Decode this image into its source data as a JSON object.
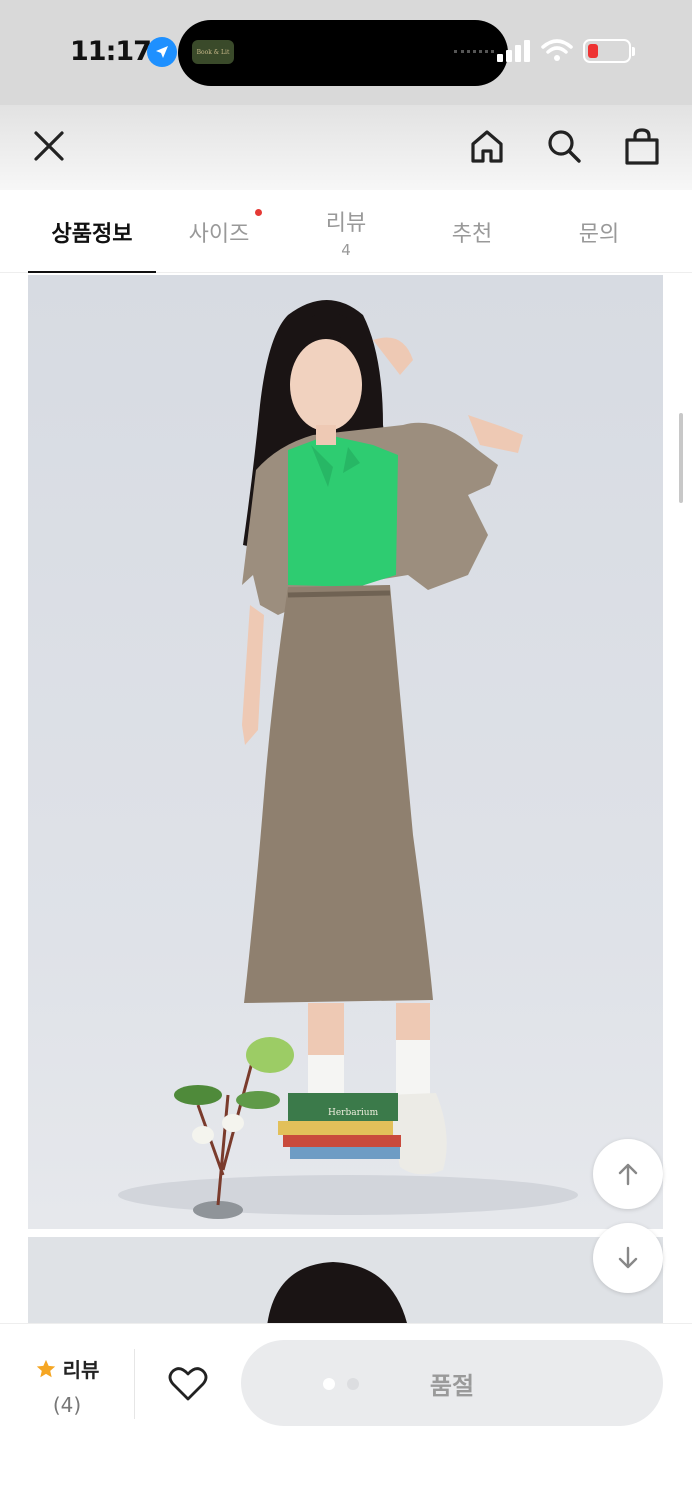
{
  "status_bar": {
    "time": "11:17",
    "island_thumb_text": "Book & Lit"
  },
  "nav": {
    "icons": [
      "close-icon",
      "home-icon",
      "search-icon",
      "shopping-bag-icon"
    ]
  },
  "tabs": [
    {
      "label": "상품정보",
      "active": true
    },
    {
      "label": "사이즈",
      "has_dot": true
    },
    {
      "label": "리뷰",
      "count": "4"
    },
    {
      "label": "추천"
    },
    {
      "label": "문의"
    }
  ],
  "photo": {
    "book_label": "Herbarium"
  },
  "bottom_bar": {
    "review_label": "리뷰",
    "review_count": "(4)",
    "soldout_label": "품절"
  },
  "colors": {
    "star": "#f5a623",
    "red_dot": "#e53935",
    "cardigan_green": "#2ecc71"
  }
}
